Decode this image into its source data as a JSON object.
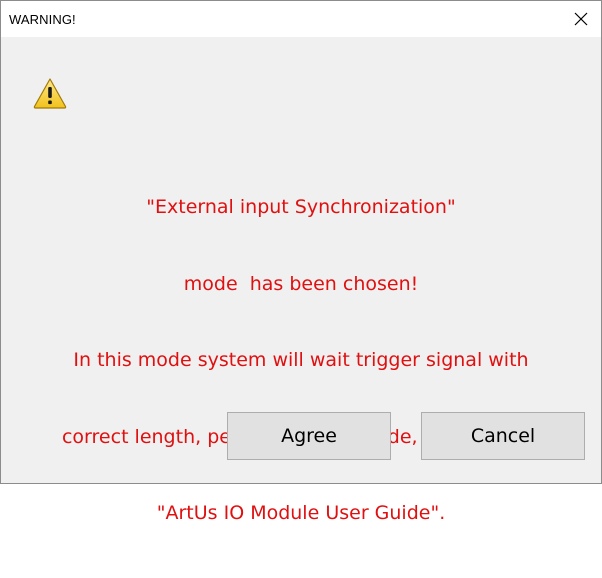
{
  "window": {
    "title": "WARNING!"
  },
  "dialog": {
    "message_lines": [
      "\"External input Synchronization\"",
      "mode  has been chosen!",
      "In this mode system will wait trigger signal with",
      "correct length, period and amplitude, described in",
      "\"ArtUs IO Module User Guide\"."
    ],
    "icon": "warning-triangle-icon"
  },
  "buttons": {
    "agree_label": "Agree",
    "cancel_label": "Cancel"
  },
  "colors": {
    "message_text": "#e01010",
    "dialog_background": "#f0f0f0",
    "button_background": "#e1e1e1"
  }
}
